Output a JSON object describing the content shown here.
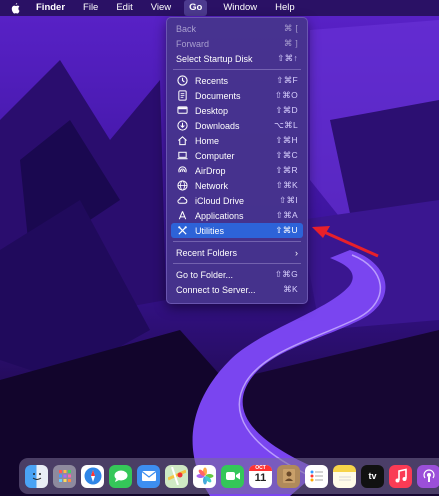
{
  "menubar": {
    "items": [
      {
        "label": "Finder",
        "bold": true
      },
      {
        "label": "File"
      },
      {
        "label": "Edit"
      },
      {
        "label": "View"
      },
      {
        "label": "Go",
        "active": true
      },
      {
        "label": "Window"
      },
      {
        "label": "Help"
      }
    ]
  },
  "go_menu": {
    "top_items": [
      {
        "label": "Back",
        "shortcut": "⌘ [",
        "disabled": true
      },
      {
        "label": "Forward",
        "shortcut": "⌘ ]",
        "disabled": true
      },
      {
        "label": "Select Startup Disk",
        "shortcut": "⇧⌘↑",
        "disabled": false
      }
    ],
    "places": [
      {
        "label": "Recents",
        "shortcut": "⇧⌘F",
        "icon": "clock-icon"
      },
      {
        "label": "Documents",
        "shortcut": "⇧⌘O",
        "icon": "document-icon"
      },
      {
        "label": "Desktop",
        "shortcut": "⇧⌘D",
        "icon": "desktop-icon"
      },
      {
        "label": "Downloads",
        "shortcut": "⌥⌘L",
        "icon": "download-icon"
      },
      {
        "label": "Home",
        "shortcut": "⇧⌘H",
        "icon": "home-icon"
      },
      {
        "label": "Computer",
        "shortcut": "⇧⌘C",
        "icon": "computer-icon"
      },
      {
        "label": "AirDrop",
        "shortcut": "⇧⌘R",
        "icon": "airdrop-icon"
      },
      {
        "label": "Network",
        "shortcut": "⇧⌘K",
        "icon": "globe-icon"
      },
      {
        "label": "iCloud Drive",
        "shortcut": "⇧⌘I",
        "icon": "cloud-icon"
      },
      {
        "label": "Applications",
        "shortcut": "⇧⌘A",
        "icon": "applications-icon"
      },
      {
        "label": "Utilities",
        "shortcut": "⇧⌘U",
        "icon": "utilities-icon",
        "highlighted": true
      }
    ],
    "recent_folders": {
      "label": "Recent Folders",
      "chevron": "›"
    },
    "bottom_items": [
      {
        "label": "Go to Folder...",
        "shortcut": "⇧⌘G"
      },
      {
        "label": "Connect to Server...",
        "shortcut": "⌘K"
      }
    ]
  },
  "dock": {
    "calendar_month": "OCT",
    "calendar_day": "11",
    "tv_label": "tv",
    "apps": [
      {
        "name": "finder-icon",
        "color": "#3a8ee6",
        "running": true
      },
      {
        "name": "launchpad-icon",
        "color": "#8a8a95",
        "running": false
      },
      {
        "name": "safari-icon",
        "color": "#2f86e8",
        "running": true
      },
      {
        "name": "messages-icon",
        "color": "#35c759",
        "running": false
      },
      {
        "name": "mail-icon",
        "color": "#3d8ef0",
        "running": false
      },
      {
        "name": "maps-icon",
        "color": "#5fbf6a",
        "running": false
      },
      {
        "name": "photos-icon",
        "color": "#ffffff",
        "running": false
      },
      {
        "name": "facetime-icon",
        "color": "#34c759",
        "running": false
      },
      {
        "name": "calendar-icon",
        "color": "#ffffff",
        "running": false
      },
      {
        "name": "contacts-icon",
        "color": "#b08a5a",
        "running": false
      },
      {
        "name": "reminders-icon",
        "color": "#ffffff",
        "running": false
      },
      {
        "name": "notes-icon",
        "color": "#f7d44a",
        "running": false
      },
      {
        "name": "apple-tv-icon",
        "color": "#111111",
        "running": false
      },
      {
        "name": "music-icon",
        "color": "#fa3b55",
        "running": false
      },
      {
        "name": "podcasts-icon",
        "color": "#9b4fd9",
        "running": false
      }
    ]
  }
}
